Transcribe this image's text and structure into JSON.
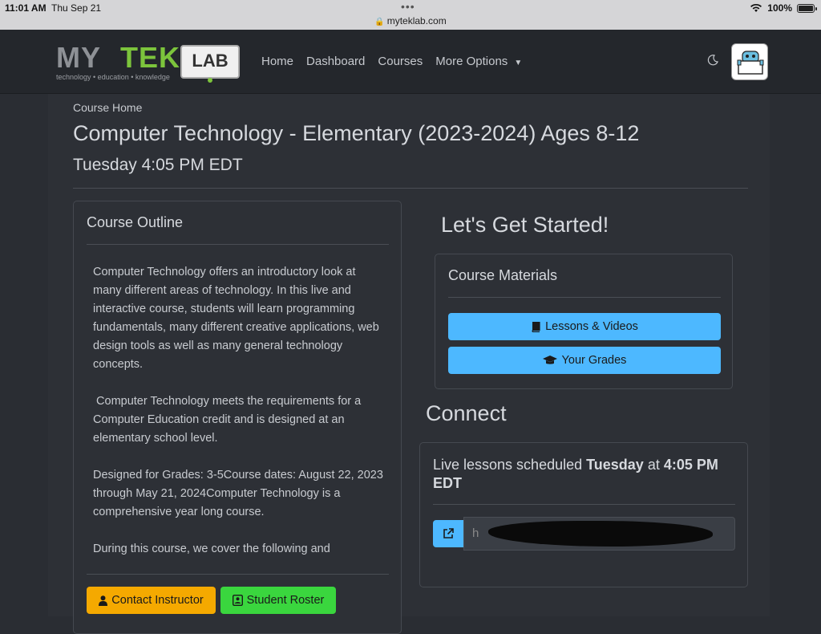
{
  "status_bar": {
    "time": "11:01 AM",
    "date": "Thu Sep 21",
    "url": "myteklab.com",
    "battery": "100%"
  },
  "nav": {
    "logo": {
      "my": "MY",
      "tek": "TEK",
      "lab": "LAB",
      "tagline": "technology • education • knowledge"
    },
    "links": [
      "Home",
      "Dashboard",
      "Courses",
      "More Options"
    ]
  },
  "page": {
    "breadcrumb": "Course Home",
    "title": "Computer Technology - Elementary (2023-2024) Ages 8-12",
    "subtitle": "Tuesday 4:05 PM EDT"
  },
  "outline": {
    "heading": "Course Outline",
    "paragraphs": [
      "Computer Technology offers an introductory look at many different areas of technology. In this live and interactive course, students will learn programming fundamentals, many different creative applications, web design tools as well as many general technology concepts.",
      " Computer Technology meets the requirements for a Computer Education credit and is designed at an elementary school level.",
      "Designed for Grades: 3-5Course dates: August 22, 2023 through May 21, 2024Computer Technology is a comprehensive year long course.",
      "During this course, we cover the following and"
    ],
    "contact_label": "Contact Instructor",
    "roster_label": "Student Roster"
  },
  "started": {
    "heading": "Let's Get Started!",
    "materials_heading": "Course Materials",
    "lessons_label": "Lessons & Videos",
    "grades_label": "Your Grades"
  },
  "connect": {
    "heading": "Connect",
    "live_prefix": "Live lessons scheduled ",
    "live_day": "Tuesday",
    "live_at": " at ",
    "live_time": "4:05 PM EDT",
    "link_value": "h"
  },
  "colors": {
    "contact": "#f5a900",
    "roster": "#3ad63e",
    "materials_button": "#4db8ff",
    "logo_green": "#7cc43c"
  }
}
